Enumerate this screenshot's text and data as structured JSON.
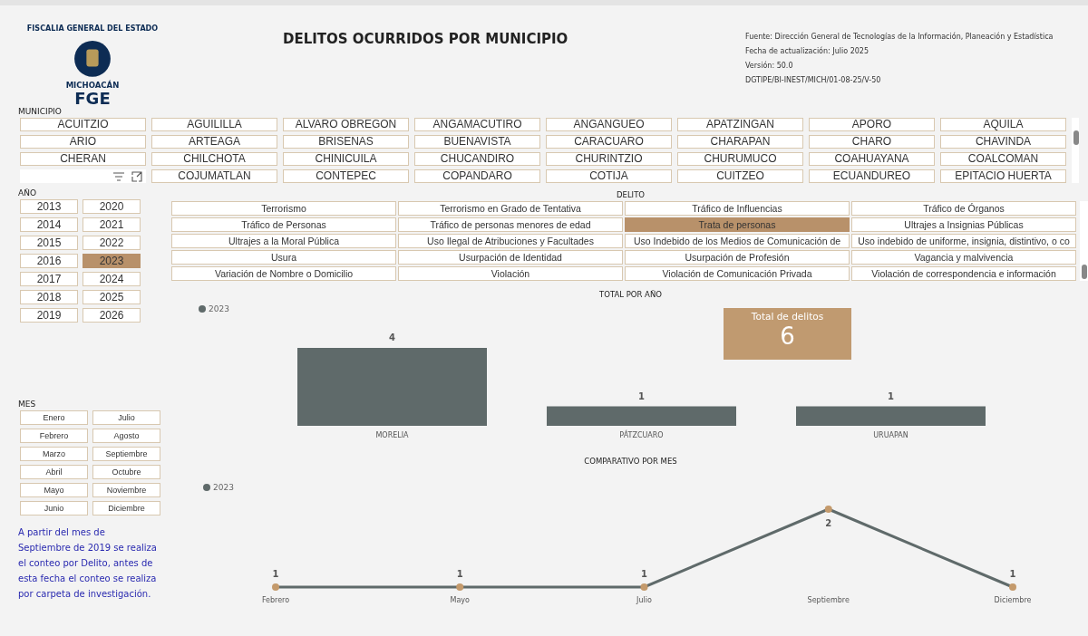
{
  "logo": {
    "arc_text": "FISCALIA GENERAL DEL ESTADO",
    "state": "MICHOACÁN",
    "acronym": "FGE"
  },
  "title": "DELITOS OCURRIDOS POR MUNICIPIO",
  "info": [
    "Fuente: Dirección General de Tecnologías de la Información, Planeación y Estadística",
    "Fecha de actualización: Julio 2025",
    "Versión: 50.0",
    "DGTIPE/BI-INEST/MICH/01-08-25/V-50"
  ],
  "municipio": {
    "label": "MUNICIPIO",
    "items": [
      {
        "label": "ACUITZIO",
        "selected": false
      },
      {
        "label": "AGUILILLA",
        "selected": false
      },
      {
        "label": "ALVARO OBREGON",
        "selected": false
      },
      {
        "label": "ANGAMACUTIRO",
        "selected": false
      },
      {
        "label": "ANGANGUEO",
        "selected": false
      },
      {
        "label": "APATZINGAN",
        "selected": false
      },
      {
        "label": "APORO",
        "selected": false
      },
      {
        "label": "AQUILA",
        "selected": false
      },
      {
        "label": "ARIO",
        "selected": false
      },
      {
        "label": "ARTEAGA",
        "selected": false
      },
      {
        "label": "BRISENAS",
        "selected": false
      },
      {
        "label": "BUENAVISTA",
        "selected": false
      },
      {
        "label": "CARACUARO",
        "selected": false
      },
      {
        "label": "CHARAPAN",
        "selected": false
      },
      {
        "label": "CHARO",
        "selected": false
      },
      {
        "label": "CHAVINDA",
        "selected": false
      },
      {
        "label": "CHERAN",
        "selected": false
      },
      {
        "label": "CHILCHOTA",
        "selected": false
      },
      {
        "label": "CHINICUILA",
        "selected": false
      },
      {
        "label": "CHUCANDIRO",
        "selected": false
      },
      {
        "label": "CHURINTZIO",
        "selected": false
      },
      {
        "label": "CHURUMUCO",
        "selected": false
      },
      {
        "label": "COAHUAYANA",
        "selected": false
      },
      {
        "label": "COALCOMAN",
        "selected": false
      },
      {
        "label": "COJUMATLAN",
        "selected": false
      },
      {
        "label": "CONTEPEC",
        "selected": false
      },
      {
        "label": "COPANDARO",
        "selected": false
      },
      {
        "label": "COTIJA",
        "selected": false
      },
      {
        "label": "CUITZEO",
        "selected": false
      },
      {
        "label": "ECUANDUREO",
        "selected": false
      },
      {
        "label": "EPITACIO HUERTA",
        "selected": false
      }
    ]
  },
  "anio": {
    "label": "AÑO",
    "items": [
      {
        "label": "2013",
        "selected": false
      },
      {
        "label": "2020",
        "selected": false
      },
      {
        "label": "2014",
        "selected": false
      },
      {
        "label": "2021",
        "selected": false
      },
      {
        "label": "2015",
        "selected": false
      },
      {
        "label": "2022",
        "selected": false
      },
      {
        "label": "2016",
        "selected": false
      },
      {
        "label": "2023",
        "selected": true
      },
      {
        "label": "2017",
        "selected": false
      },
      {
        "label": "2024",
        "selected": false
      },
      {
        "label": "2018",
        "selected": false
      },
      {
        "label": "2025",
        "selected": false
      },
      {
        "label": "2019",
        "selected": false
      },
      {
        "label": "2026",
        "selected": false
      }
    ]
  },
  "mes": {
    "label": "MES",
    "items": [
      {
        "label": "Enero",
        "selected": false
      },
      {
        "label": "Julio",
        "selected": false
      },
      {
        "label": "Febrero",
        "selected": false
      },
      {
        "label": "Agosto",
        "selected": false
      },
      {
        "label": "Marzo",
        "selected": false
      },
      {
        "label": "Septiembre",
        "selected": false
      },
      {
        "label": "Abril",
        "selected": false
      },
      {
        "label": "Octubre",
        "selected": false
      },
      {
        "label": "Mayo",
        "selected": false
      },
      {
        "label": "Noviembre",
        "selected": false
      },
      {
        "label": "Junio",
        "selected": false
      },
      {
        "label": "Diciembre",
        "selected": false
      }
    ]
  },
  "note": "A partir  del mes de Septiembre de 2019 se realiza  el conteo por Delito, antes de esta fecha el conteo se realiza por carpeta de investigación.",
  "delito": {
    "label": "DELITO",
    "items": [
      {
        "label": "Terrorismo",
        "selected": false
      },
      {
        "label": "Terrorismo en Grado de Tentativa",
        "selected": false
      },
      {
        "label": "Tráfico de Influencias",
        "selected": false
      },
      {
        "label": "Tráfico de Órganos",
        "selected": false
      },
      {
        "label": "Tráfico de Personas",
        "selected": false
      },
      {
        "label": "Tráfico de personas menores de edad",
        "selected": false
      },
      {
        "label": "Trata de personas",
        "selected": true
      },
      {
        "label": "Ultrajes a Insignias Públicas",
        "selected": false
      },
      {
        "label": "Ultrajes a la Moral Pública",
        "selected": false
      },
      {
        "label": "Uso Ilegal de Atribuciones y Facultades",
        "selected": false
      },
      {
        "label": "Uso Indebido de los Medios de Comunicación de",
        "selected": false
      },
      {
        "label": "Uso indebido de uniforme, insignia, distintivo, o co",
        "selected": false
      },
      {
        "label": "Usura",
        "selected": false
      },
      {
        "label": "Usurpación de Identidad",
        "selected": false
      },
      {
        "label": "Usurpación de Profesión",
        "selected": false
      },
      {
        "label": "Vagancia y malvivencia",
        "selected": false
      },
      {
        "label": "Variación de Nombre o Domicilio",
        "selected": false
      },
      {
        "label": "Violación",
        "selected": false
      },
      {
        "label": "Violación de Comunicación Privada",
        "selected": false
      },
      {
        "label": "Violación de correspondencia e información",
        "selected": false
      }
    ]
  },
  "total_por_anio": {
    "title": "TOTAL POR AÑO",
    "kpi": {
      "label": "Total de delitos",
      "value": "6"
    },
    "chart_data": {
      "type": "bar",
      "categories": [
        "MORELIA",
        "PÁTZCUARO",
        "URUAPAN"
      ],
      "series": [
        {
          "name": "2023",
          "color": "#5f6a6a",
          "values": [
            4,
            1,
            1
          ]
        }
      ],
      "data_labels": true
    }
  },
  "comparativo_por_mes": {
    "title": "COMPARATIVO POR MES",
    "chart_data": {
      "type": "line",
      "categories": [
        "Febrero",
        "Mayo",
        "Julio",
        "Septiembre",
        "Diciembre"
      ],
      "series": [
        {
          "name": "2023",
          "color": "#5f6a6a",
          "marker": true,
          "values": [
            1,
            1,
            1,
            2,
            1
          ]
        }
      ],
      "data_labels": true
    }
  }
}
